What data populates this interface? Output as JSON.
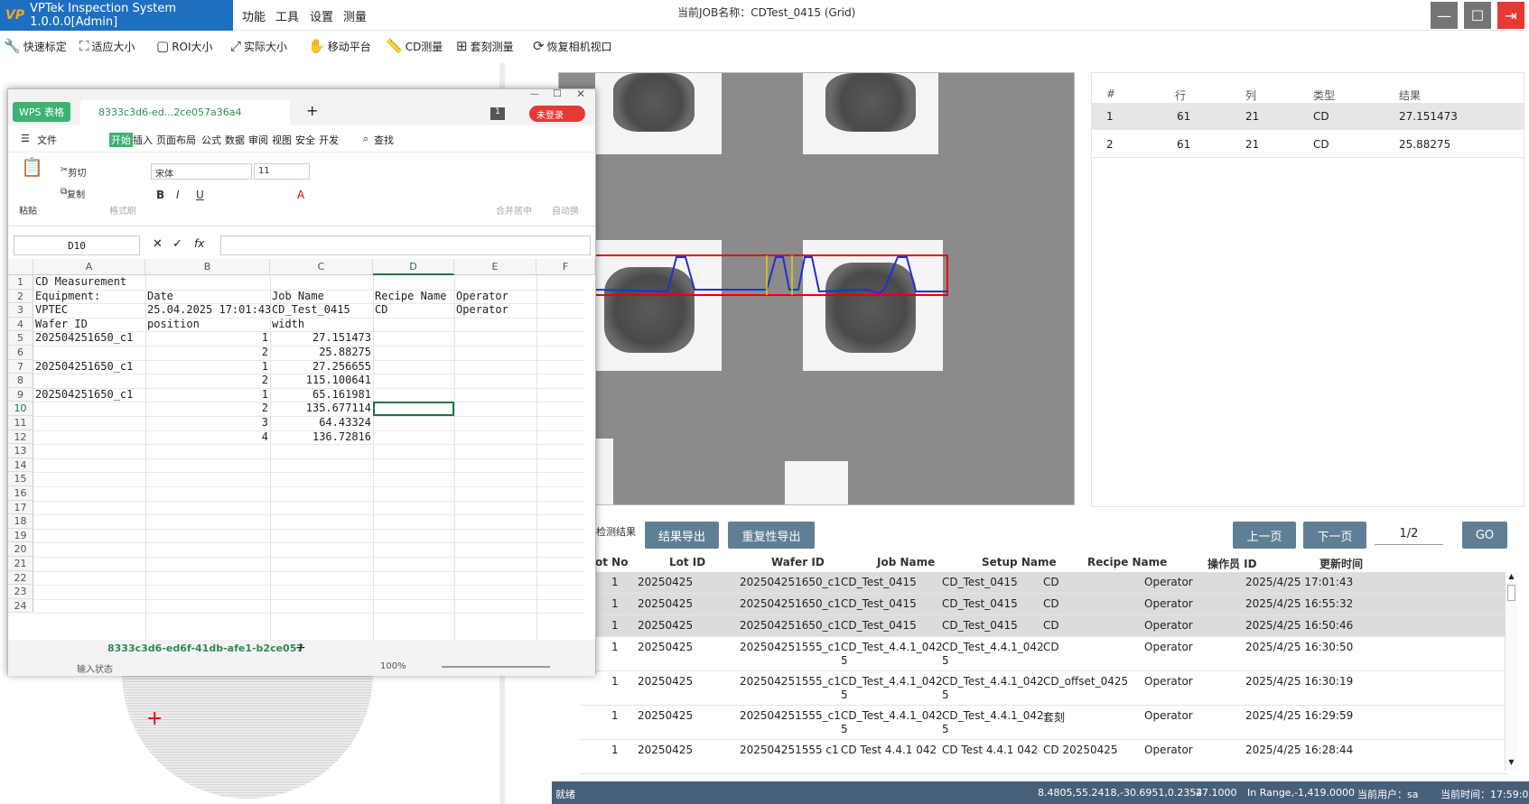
{
  "app": {
    "title": "VPTek Inspection System 1.0.0.0[Admin]",
    "logo": "VP",
    "menus": [
      "功能",
      "工具",
      "设置",
      "测量"
    ],
    "job_title": "当前JOB名称：CDTest_0415 (Grid)"
  },
  "window_controls": {
    "minimize": "—",
    "maximize": "☐",
    "close": "⇥"
  },
  "toolbar": [
    {
      "icon": "wrench-icon",
      "glyph": "🔧",
      "label": "快速标定"
    },
    {
      "icon": "fit-icon",
      "glyph": "⛶",
      "label": "适应大小"
    },
    {
      "icon": "roi-icon",
      "glyph": "▢",
      "label": "ROI大小"
    },
    {
      "icon": "actual-size-icon",
      "glyph": "⤢",
      "label": "实际大小"
    },
    {
      "icon": "hand-icon",
      "glyph": "✋",
      "label": "移动平台"
    },
    {
      "icon": "ruler-icon",
      "glyph": "📏",
      "label": "CD测量"
    },
    {
      "icon": "plus-box-icon",
      "glyph": "⊞",
      "label": "套刻测量"
    },
    {
      "icon": "camera-refresh-icon",
      "glyph": "⟳",
      "label": "恢复相机视口"
    }
  ],
  "results_table": {
    "headers": [
      "#",
      "行",
      "列",
      "类型",
      "结果"
    ],
    "rows": [
      [
        "1",
        "61",
        "21",
        "CD",
        "27.151473"
      ],
      [
        "2",
        "61",
        "21",
        "CD",
        "25.88275"
      ]
    ]
  },
  "bottom": {
    "section_label": "检测结果",
    "export_button": "结果导出",
    "repeat_export_button": "重复性导出",
    "prev_button": "上一页",
    "next_button": "下一页",
    "page": "1/2",
    "go_button": "GO",
    "headers": [
      "ot No",
      "Lot ID",
      "Wafer ID",
      "Job Name",
      "Setup Name",
      "Recipe Name",
      "操作员 ID",
      "更新时间"
    ],
    "rows": [
      {
        "no": "1",
        "lot": "20250425",
        "wafer": "202504251650_c1",
        "job": "CD_Test_0415",
        "job2": "",
        "setup": "CD_Test_0415",
        "setup2": "",
        "recipe": "CD",
        "op": "Operator",
        "time": "2025/4/25 17:01:43"
      },
      {
        "no": "1",
        "lot": "20250425",
        "wafer": "202504251650_c1",
        "job": "CD_Test_0415",
        "job2": "",
        "setup": "CD_Test_0415",
        "setup2": "",
        "recipe": "CD",
        "op": "Operator",
        "time": "2025/4/25 16:55:32"
      },
      {
        "no": "1",
        "lot": "20250425",
        "wafer": "202504251650_c1",
        "job": "CD_Test_0415",
        "job2": "",
        "setup": "CD_Test_0415",
        "setup2": "",
        "recipe": "CD",
        "op": "Operator",
        "time": "2025/4/25 16:50:46"
      },
      {
        "no": "1",
        "lot": "20250425",
        "wafer": "202504251555_c1",
        "job": "CD_Test_4.4.1_042",
        "job2": "5",
        "setup": "CD_Test_4.4.1_042",
        "setup2": "5",
        "recipe": "CD",
        "op": "Operator",
        "time": "2025/4/25 16:30:50"
      },
      {
        "no": "1",
        "lot": "20250425",
        "wafer": "202504251555_c1",
        "job": "CD_Test_4.4.1_042",
        "job2": "5",
        "setup": "CD_Test_4.4.1_042",
        "setup2": "5",
        "recipe": "CD_offset_0425",
        "op": "Operator",
        "time": "2025/4/25 16:30:19"
      },
      {
        "no": "1",
        "lot": "20250425",
        "wafer": "202504251555_c1",
        "job": "CD_Test_4.4.1_042",
        "job2": "5",
        "setup": "CD_Test_4.4.1_042",
        "setup2": "5",
        "recipe": "套刻",
        "op": "Operator",
        "time": "2025/4/25 16:29:59"
      },
      {
        "no": "1",
        "lot": "20250425",
        "wafer": "202504251555 c1",
        "job": "CD Test 4.4.1 042",
        "job2": "",
        "setup": "CD Test 4.4.1 042",
        "setup2": "",
        "recipe": "CD 20250425",
        "op": "Operator",
        "time": "2025/4/25 16:28:44"
      }
    ]
  },
  "statusbar": {
    "ready": "就绪",
    "coords": "8.4805,55.2418,-30.6951,0.2354",
    "value": "27.1000",
    "range": "In Range,-1,419.0000",
    "user": "当前用户：sa",
    "time": "当前时间：17:59:02"
  },
  "wps": {
    "logo": "WPS 表格",
    "file_tab": "8333c3d6-ed...2ce057a36a4",
    "tab_badge": "1",
    "login": "未登录",
    "menu": {
      "file": "文件",
      "start": "开始",
      "insert": "插入",
      "layout": "页面布局",
      "formula": "公式",
      "data": "数据",
      "review": "审阅",
      "view": "视图",
      "security": "安全",
      "dev": "开发",
      "search": "查找"
    },
    "ribbon": {
      "paste": "粘贴",
      "cut": "剪切",
      "copy": "复制",
      "format_painter": "格式刷",
      "font": "宋体",
      "size": "11",
      "merge": "合并居中",
      "wrap": "自动换"
    },
    "name_box": "D10",
    "fx": "fx",
    "columns": [
      "A",
      "B",
      "C",
      "D",
      "E",
      "F"
    ],
    "rows": [
      "1",
      "2",
      "3",
      "4",
      "5",
      "6",
      "7",
      "8",
      "9",
      "10",
      "11",
      "12",
      "13",
      "14",
      "15",
      "16",
      "17",
      "18",
      "19",
      "20",
      "21",
      "22",
      "23",
      "24"
    ],
    "cells": {
      "r1": [
        "CD Measurement",
        "",
        "",
        "",
        ""
      ],
      "r2": [
        "Equipment:",
        "Date",
        "Job Name",
        "Recipe Name",
        "Operator"
      ],
      "r3": [
        "VPTEC",
        "25.04.2025 17:01:43",
        "CD_Test_0415",
        "CD",
        "Operator"
      ],
      "r4": [
        "Wafer ID",
        "position",
        "width",
        "",
        ""
      ],
      "r5": [
        "202504251650_c1",
        "1",
        "27.151473",
        "",
        ""
      ],
      "r6": [
        "",
        "2",
        "25.88275",
        "",
        ""
      ],
      "r7": [
        "202504251650_c1",
        "1",
        "27.256655",
        "",
        ""
      ],
      "r8": [
        "",
        "2",
        "115.100641",
        "",
        ""
      ],
      "r9": [
        "202504251650_c1",
        "1",
        "65.161981",
        "",
        ""
      ],
      "r10": [
        "",
        "2",
        "135.677114",
        "",
        ""
      ],
      "r11": [
        "",
        "3",
        "64.43324",
        "",
        ""
      ],
      "r12": [
        "",
        "4",
        "136.72816",
        "",
        ""
      ]
    },
    "sheet_tab": "8333c3d6-ed6f-41db-afe1-b2ce057",
    "status": "输入状态",
    "zoom": "100%"
  }
}
